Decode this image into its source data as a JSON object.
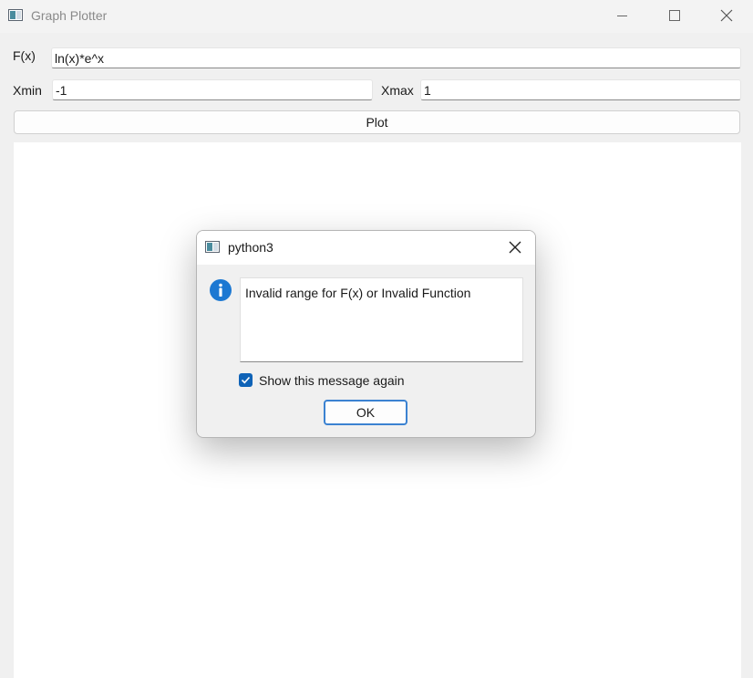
{
  "window": {
    "title": "Graph Plotter",
    "controls": [
      "minimize",
      "maximize",
      "close"
    ]
  },
  "form": {
    "fx_label": "F(x)",
    "fx_value": "ln(x)*e^x",
    "xmin_label": "Xmin",
    "xmin_value": "-1",
    "xmax_label": "Xmax",
    "xmax_value": "1",
    "plot_button": "Plot"
  },
  "dialog": {
    "title": "python3",
    "message": "Invalid range for F(x) or Invalid Function",
    "checkbox_label": "Show this message again",
    "checkbox_checked": true,
    "ok_button": "OK",
    "icon": "info-icon"
  },
  "colors": {
    "accent": "#0f63b7",
    "info_icon": "#1c78d2",
    "background": "#f0f0f0"
  }
}
